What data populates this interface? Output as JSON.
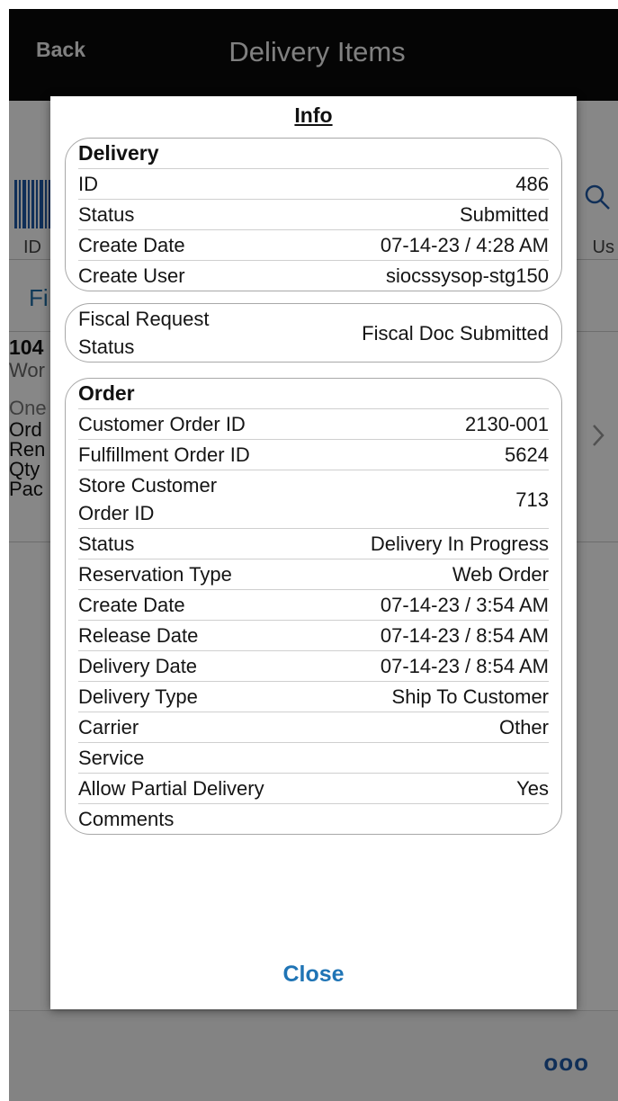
{
  "header": {
    "back_label": "Back",
    "title": "Delivery Items"
  },
  "background": {
    "scan_label": "ID",
    "user_label": "Us",
    "filter_label": "Fi",
    "list_item": {
      "line1": "104",
      "line2": "Wor",
      "line3": "One",
      "line4": "Ord",
      "line5": "Ren",
      "line6": "Qty",
      "line7": "Pac"
    },
    "more_label": "ooo",
    "icons": [
      "barcode-icon",
      "search-icon",
      "chevron-right-icon"
    ]
  },
  "dialog": {
    "title": "Info",
    "delivery": {
      "header": "Delivery",
      "rows": [
        {
          "label": "ID",
          "value": "486"
        },
        {
          "label": "Status",
          "value": "Submitted"
        },
        {
          "label": "Create Date",
          "value": "07-14-23 / 4:28 AM"
        },
        {
          "label": "Create User",
          "value": "siocssysop-stg150"
        }
      ]
    },
    "fiscal": {
      "rows": [
        {
          "label": "Fiscal Request\nStatus",
          "value": "Fiscal Doc Submitted"
        }
      ]
    },
    "order": {
      "header": "Order",
      "rows": [
        {
          "label": "Customer Order ID",
          "value": "2130-001"
        },
        {
          "label": "Fulfillment Order ID",
          "value": "5624"
        },
        {
          "label": "Store Customer\nOrder ID",
          "value": "713"
        },
        {
          "label": "Status",
          "value": "Delivery In Progress"
        },
        {
          "label": "Reservation Type",
          "value": "Web Order"
        },
        {
          "label": "Create Date",
          "value": "07-14-23 / 3:54 AM"
        },
        {
          "label": "Release Date",
          "value": "07-14-23 / 8:54 AM"
        },
        {
          "label": "Delivery Date",
          "value": "07-14-23 / 8:54 AM"
        },
        {
          "label": "Delivery Type",
          "value": "Ship To Customer"
        },
        {
          "label": "Carrier",
          "value": "Other"
        },
        {
          "label": "Service",
          "value": ""
        },
        {
          "label": "Allow Partial Delivery",
          "value": "Yes"
        },
        {
          "label": "Comments",
          "value": ""
        }
      ]
    },
    "close_label": "Close"
  },
  "colors": {
    "header_bg": "#0b0b0b",
    "accent": "#1f74b5",
    "overlay": "rgba(0,0,0,0.47)"
  }
}
